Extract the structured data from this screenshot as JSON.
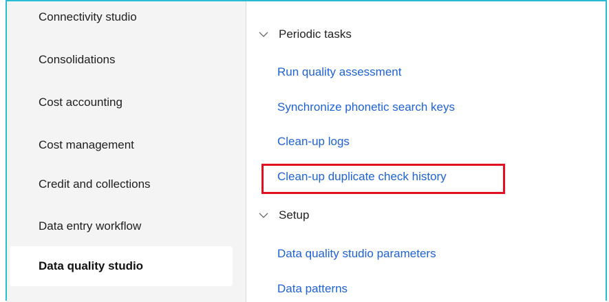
{
  "sidebar": {
    "items": [
      {
        "label": "Connectivity studio"
      },
      {
        "label": "Consolidations"
      },
      {
        "label": "Cost accounting"
      },
      {
        "label": "Cost management"
      },
      {
        "label": "Credit and collections"
      },
      {
        "label": "Data entry workflow"
      },
      {
        "label": "Data quality studio",
        "selected": true
      }
    ]
  },
  "main": {
    "groups": [
      {
        "title": "Periodic tasks",
        "links": [
          {
            "label": "Run quality assessment"
          },
          {
            "label": "Synchronize phonetic search keys"
          },
          {
            "label": "Clean-up logs"
          },
          {
            "label": "Clean-up duplicate check history",
            "highlighted": true
          }
        ]
      },
      {
        "title": "Setup",
        "links": [
          {
            "label": "Data quality studio parameters"
          },
          {
            "label": "Data patterns"
          }
        ]
      }
    ]
  },
  "colors": {
    "frame_accent": "#27bcd3",
    "link": "#1e62d6",
    "highlight_box": "#e10f1f",
    "sidebar_bg": "#f4f4f4"
  },
  "icons": {
    "group_expand": "chevron-down-icon"
  }
}
